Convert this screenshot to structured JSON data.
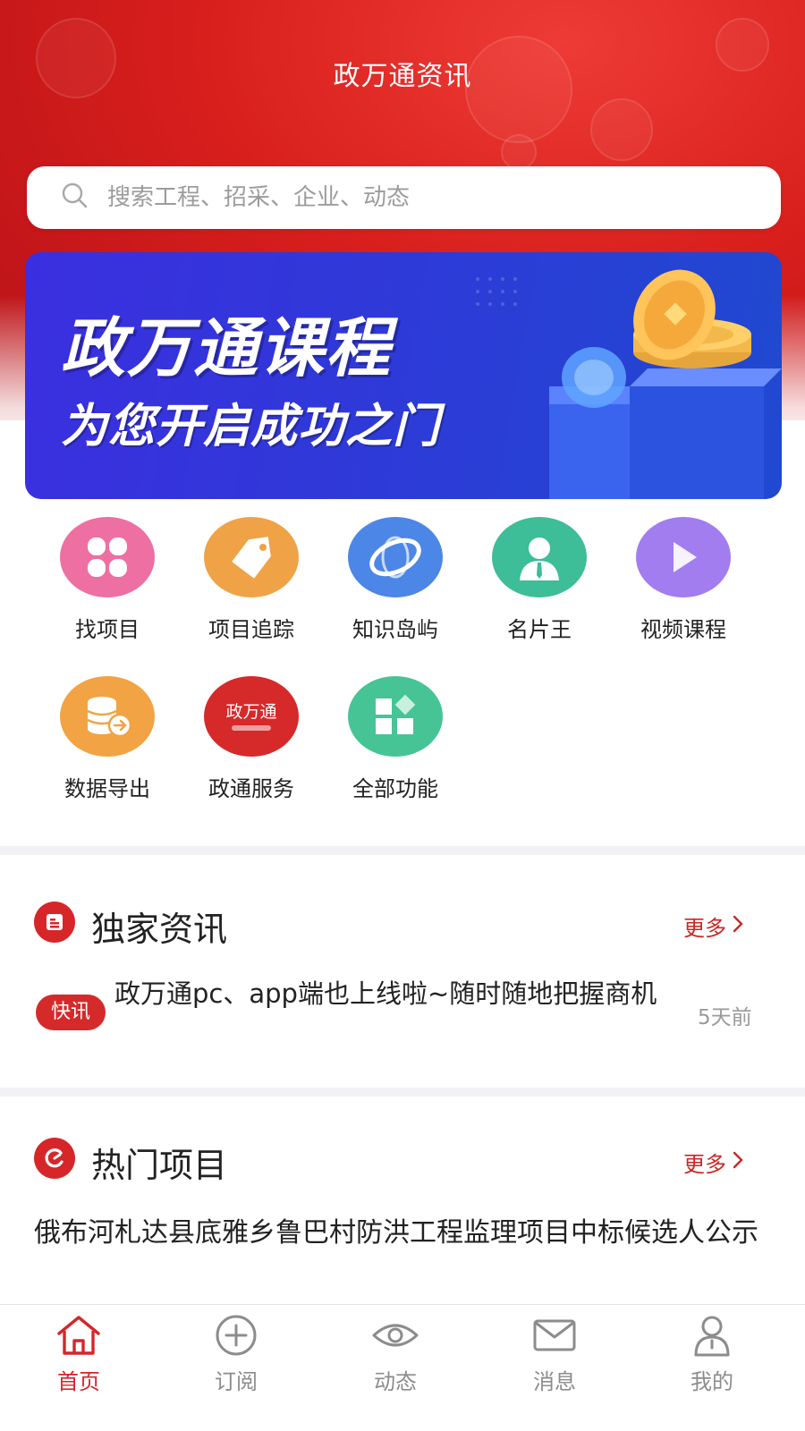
{
  "header": {
    "title": "政万通资讯"
  },
  "search": {
    "placeholder": "搜索工程、招采、企业、动态"
  },
  "banner": {
    "title": "政万通课程",
    "subtitle": "为您开启成功之门"
  },
  "functions": [
    {
      "label": "找项目",
      "icon": "clover-icon",
      "color": "#ee6fa2"
    },
    {
      "label": "项目追踪",
      "icon": "tag-icon",
      "color": "#f0a246"
    },
    {
      "label": "知识岛屿",
      "icon": "globe-icon",
      "color": "#4c86e6"
    },
    {
      "label": "名片王",
      "icon": "person-icon",
      "color": "#3dbd98"
    },
    {
      "label": "视频课程",
      "icon": "play-icon",
      "color": "#a17df0"
    },
    {
      "label": "数据导出",
      "icon": "database-export-icon",
      "color": "#f2a343"
    },
    {
      "label": "政通服务",
      "icon": "zhengwantong-logo-icon",
      "color": "#d62929",
      "icon_text": "政万通"
    },
    {
      "label": "全部功能",
      "icon": "grid-icon",
      "color": "#46c496"
    }
  ],
  "exclusive_news": {
    "title": "独家资讯",
    "more_label": "更多",
    "item": {
      "badge": "快讯",
      "text": "政万通pc、app端也上线啦~随时随地把握商机",
      "time": "5天前"
    }
  },
  "hot_projects": {
    "title": "热门项目",
    "more_label": "更多",
    "item": {
      "text": "俄布河札达县底雅乡鲁巴村防洪工程监理项目中标候选人公示"
    }
  },
  "tabbar": [
    {
      "label": "首页",
      "icon": "home-icon",
      "active": true
    },
    {
      "label": "订阅",
      "icon": "plus-circle-icon",
      "active": false
    },
    {
      "label": "动态",
      "icon": "eye-icon",
      "active": false
    },
    {
      "label": "消息",
      "icon": "mail-icon",
      "active": false
    },
    {
      "label": "我的",
      "icon": "user-icon",
      "active": false
    }
  ],
  "colors": {
    "brand_red": "#d5262a",
    "banner_blue": "#2f39d8",
    "muted": "#8c8c8c"
  }
}
